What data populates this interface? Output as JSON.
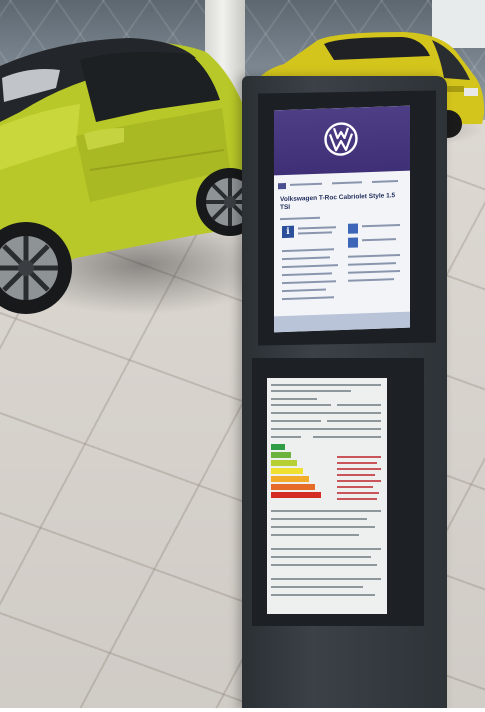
{
  "scene": {
    "setting": "showroom",
    "kiosk": {
      "upper_screen": {
        "brand_icon": "vw-logo-icon",
        "header_color": "#3f2f77",
        "car_title": "Volkswagen T-Roc Cabriolet Style 1.5 TSI"
      },
      "lower_screen": {
        "efficiency_colors": [
          "#2e9d44",
          "#6bb33d",
          "#b6cf33",
          "#f0e02f",
          "#f2ac2a",
          "#e66b26",
          "#d42c25"
        ]
      }
    },
    "cars": [
      {
        "name": "front-car",
        "color": "#b7c62a"
      },
      {
        "name": "back-car",
        "color": "#d7cb1c"
      }
    ]
  }
}
